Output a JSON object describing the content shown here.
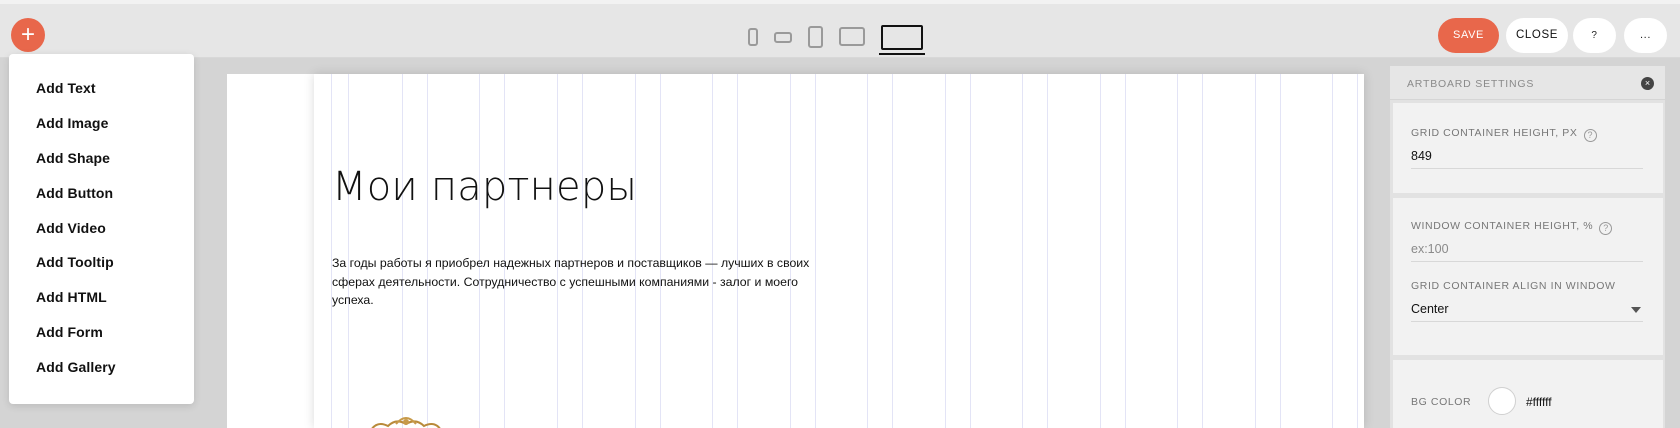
{
  "toolbar": {
    "add_label": "+",
    "devices": [
      "phone-portrait-icon",
      "phone-landscape-icon",
      "tablet-portrait-icon",
      "tablet-landscape-icon",
      "desktop-icon"
    ],
    "save_label": "SAVE",
    "close_label": "CLOSE",
    "help_label": "?",
    "more_label": "..."
  },
  "add_menu": {
    "items": [
      "Add Text",
      "Add Image",
      "Add Shape",
      "Add Button",
      "Add Video",
      "Add Tooltip",
      "Add HTML",
      "Add Form",
      "Add Gallery"
    ]
  },
  "artboard": {
    "heading": "Мои партнеры",
    "paragraph": "За годы работы я приобрел надежных партнеров и поставщиков — лучших в своих сферах деятельности. Сотрудничество с успешными компаниями - залог и моего успеха."
  },
  "settings_panel": {
    "title": "ARTBOARD SETTINGS",
    "close_icon": "×",
    "help_icon": "?",
    "grid_height_label": "GRID CONTAINER HEIGHT, PX",
    "grid_height_value": "849",
    "window_height_label": "WINDOW CONTAINER HEIGHT, %",
    "window_height_placeholder": "ex:100",
    "align_label": "GRID CONTAINER ALIGN IN WINDOW",
    "align_value": "Center",
    "bg_color_label": "BG COLOR",
    "bg_color_value": "#ffffff"
  },
  "colors": {
    "accent": "#e8674b",
    "toolbar_bg": "#e6e6e6",
    "gridline": "#e3e4f6"
  }
}
